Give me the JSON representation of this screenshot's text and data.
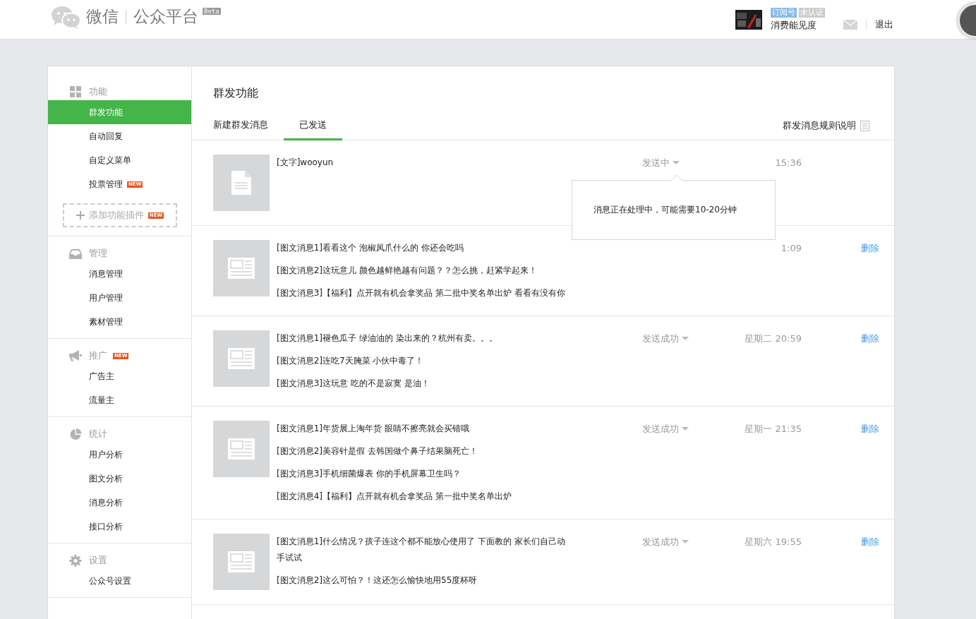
{
  "header": {
    "brand": "微信",
    "product": "公众平台",
    "beta": "Beta",
    "account_tags": [
      {
        "label": "订阅号",
        "color": "#8ab9e8"
      },
      {
        "label": "未认证",
        "color": "#cccccc"
      }
    ],
    "account_name": "消费能见度",
    "logout": "退出"
  },
  "sidebar": {
    "groups": [
      {
        "title": "功能",
        "items": [
          {
            "label": "群发功能",
            "selected": true
          },
          {
            "label": "自动回复",
            "selected": false
          },
          {
            "label": "自定义菜单",
            "selected": false
          },
          {
            "label": "投票管理",
            "selected": false,
            "badge": "NEW"
          }
        ],
        "add_button": {
          "label": "添加功能插件",
          "badge": "NEW"
        }
      },
      {
        "title": "管理",
        "items": [
          {
            "label": "消息管理",
            "selected": false
          },
          {
            "label": "用户管理",
            "selected": false
          },
          {
            "label": "素材管理",
            "selected": false
          }
        ]
      },
      {
        "title": "推广",
        "badge": "NEW",
        "items": [
          {
            "label": "广告主",
            "selected": false
          },
          {
            "label": "流量主",
            "selected": false
          }
        ]
      },
      {
        "title": "统计",
        "items": [
          {
            "label": "用户分析",
            "selected": false
          },
          {
            "label": "图文分析",
            "selected": false
          },
          {
            "label": "消息分析",
            "selected": false
          },
          {
            "label": "接口分析",
            "selected": false
          }
        ]
      },
      {
        "title": "设置",
        "items": [
          {
            "label": "公众号设置",
            "selected": false
          }
        ]
      }
    ]
  },
  "content": {
    "title": "群发功能",
    "tabs": [
      {
        "label": "新建群发消息",
        "selected": false
      },
      {
        "label": "已发送",
        "selected": true
      }
    ],
    "rules_link": "群发消息规则说明",
    "messages": [
      {
        "kind": "text",
        "lines": [
          "[文字]wooyun"
        ],
        "status": "发送中",
        "time": "15:36",
        "tooltip": "消息正在处理中，可能需要10-20分钟"
      },
      {
        "kind": "news",
        "lines": [
          "[图文消息1]看看这个 泡椒凤爪什么的 你还会吃吗",
          "[图文消息2]这玩意儿 颜色越鲜艳越有问题？？怎么挑，赶紧学起来！",
          "[图文消息3]【福利】点开就有机会拿奖品 第二批中奖名单出炉 看看有没有你"
        ],
        "time": "1:09",
        "delete": "删除"
      },
      {
        "kind": "news",
        "lines": [
          "[图文消息1]褪色瓜子 绿油油的 染出来的？杭州有卖。。。",
          "[图文消息2]连吃7天腌菜 小伙中毒了！",
          "[图文消息3]这玩意 吃的不是寂寞 是油！"
        ],
        "status": "发送成功",
        "time": "星期二 20:59",
        "delete": "删除"
      },
      {
        "kind": "news",
        "lines": [
          "[图文消息1]年货展上淘年货 眼睛不擦亮就会买错哦",
          "[图文消息2]美容针是假 去韩国做个鼻子结果脑死亡！",
          "[图文消息3]手机细菌爆表 你的手机屏幕卫生吗？",
          "[图文消息4]【福利】点开就有机会拿奖品 第一批中奖名单出炉"
        ],
        "status": "发送成功",
        "time": "星期一 21:35",
        "delete": "删除"
      },
      {
        "kind": "news",
        "lines": [
          "[图文消息1]什么情况？孩子连这个都不能放心使用了 下面教的 家长们自己动手试试",
          "[图文消息2]这么可怕？！这还怎么愉快地用55度杯呀"
        ],
        "status": "发送成功",
        "time": "星期六 19:55",
        "delete": "删除"
      }
    ]
  }
}
